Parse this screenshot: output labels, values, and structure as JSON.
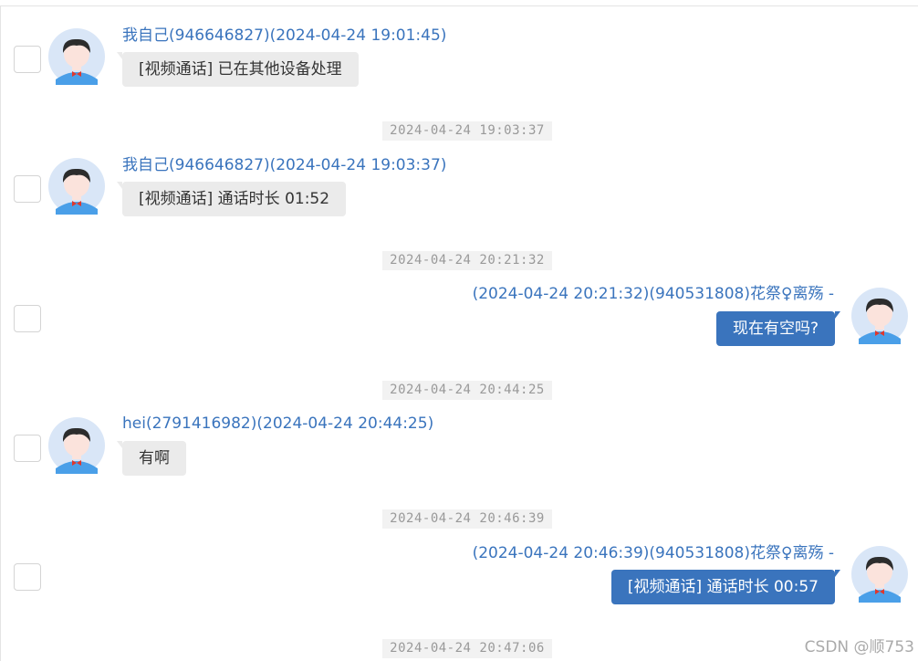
{
  "messages": [
    {
      "direction": "in",
      "sender": "我自己(946646827)(2024-04-24 19:01:45)",
      "text": "[视频通话] 已在其他设备处理"
    },
    {
      "separator": "2024-04-24 19:03:37"
    },
    {
      "direction": "in",
      "sender": "我自己(946646827)(2024-04-24 19:03:37)",
      "text": "[视频通话] 通话时长 01:52"
    },
    {
      "separator": "2024-04-24 20:21:32"
    },
    {
      "direction": "out",
      "sender": "(2024-04-24 20:21:32)(940531808)花祭♀离殇 -",
      "text": "现在有空吗?"
    },
    {
      "separator": "2024-04-24 20:44:25"
    },
    {
      "direction": "in",
      "sender": "hei(2791416982)(2024-04-24 20:44:25)",
      "text": "有啊"
    },
    {
      "separator": "2024-04-24 20:46:39"
    },
    {
      "direction": "out",
      "sender": "(2024-04-24 20:46:39)(940531808)花祭♀离殇 -",
      "text": "[视频通话] 通话时长 00:57"
    },
    {
      "separator": "2024-04-24 20:47:06"
    }
  ],
  "watermark": "CSDN @顺753",
  "colors": {
    "sender_text": "#3a74bd",
    "outgoing_bubble": "#3a74bd",
    "incoming_bubble": "#ebebeb",
    "separator_bg": "#f2f2f2"
  },
  "icons": {
    "avatar": "avatar-icon"
  }
}
